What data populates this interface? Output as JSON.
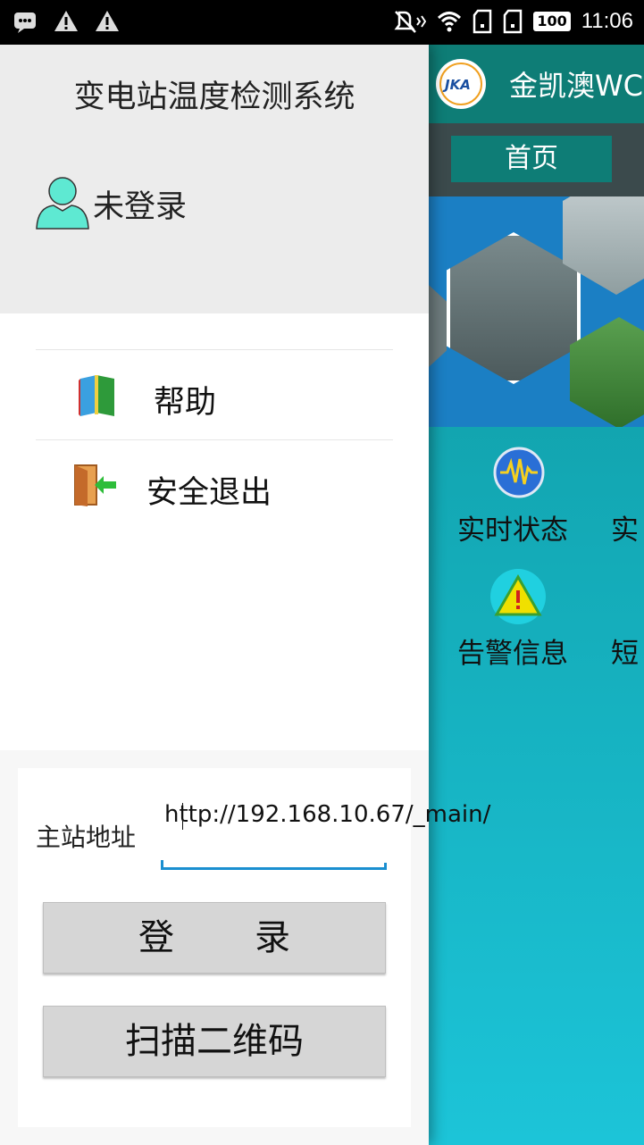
{
  "status_bar": {
    "time": "11:06",
    "battery": "100"
  },
  "background_app": {
    "title": "金凯澳WC",
    "logo_text": "JKA",
    "tab_home": "首页",
    "features": [
      "实时状态",
      "实",
      "告警信息",
      "短"
    ]
  },
  "drawer": {
    "title": "变电站温度检测系统",
    "user_status": "未登录",
    "menu": [
      {
        "label": "帮助",
        "icon": "book-icon"
      },
      {
        "label": "安全退出",
        "icon": "exit-door-icon"
      }
    ],
    "form": {
      "address_label": "主站地址",
      "address_value": "http://192.168.10.67/_main/",
      "login_button": "登录",
      "scan_button": "扫描二维码"
    }
  },
  "colors": {
    "app_header": "#0e7d76",
    "accent_input": "#1a8fd0",
    "user_icon": "#5ee9d2"
  }
}
